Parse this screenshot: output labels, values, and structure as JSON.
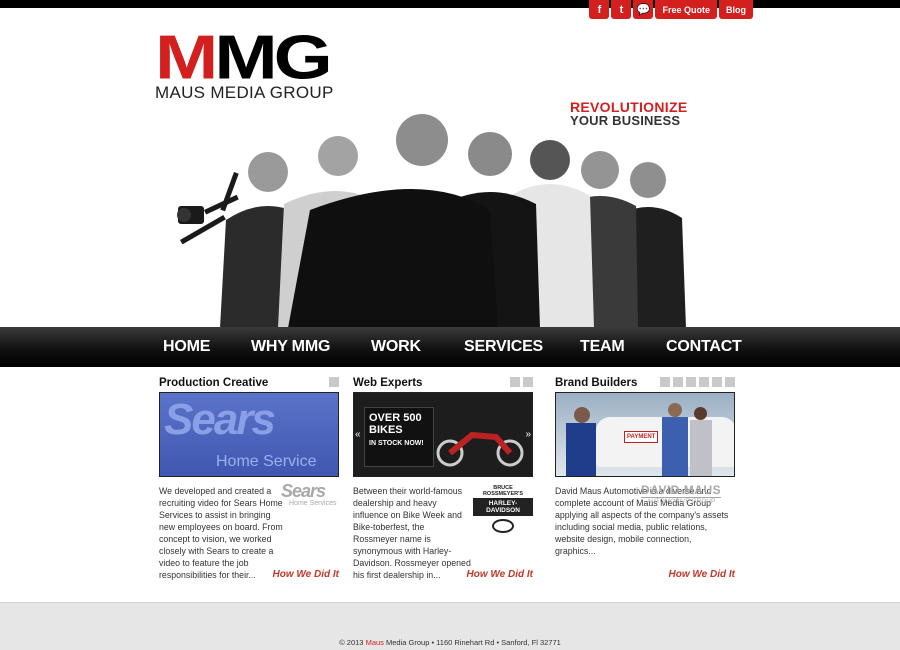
{
  "top_actions": {
    "facebook": "f",
    "twitter": "t",
    "chat": "💬",
    "free_quote": "Free Quote",
    "blog": "Blog"
  },
  "logo": {
    "mark_red": "M",
    "mark_black": "M",
    "mark_g": "G",
    "name": "MAUS MEDIA GROUP"
  },
  "tagline": {
    "line1": "REVOLUTIONIZE",
    "line2": "YOUR BUSINESS"
  },
  "nav": {
    "items": [
      "HOME",
      "WHY MMG",
      "WORK",
      "SERVICES",
      "TEAM",
      "CONTACT"
    ]
  },
  "columns": [
    {
      "title": "Production Creative",
      "thumb_text": "Sears",
      "thumb_sub": "Home Service",
      "brand": "Sears",
      "brand_sub": "Home Services",
      "body": "We developed and created a recruiting video for Sears Home Services to assist in bringing new employees on board. From concept to vision, we worked closely with Sears to create a video to feature the job responsibilities for their...",
      "link": "How We Did It"
    },
    {
      "title": "Web Experts",
      "thumb_text": "OVER 500 BIKES",
      "thumb_sub": "IN STOCK NOW!",
      "brand": "HARLEY-DAVIDSON",
      "brand_sub": "BRUCE ROSSMEYER'S",
      "body": "Between their world-famous dealership and heavy influence on Bike Week and Bike-toberfest, the Rossmeyer name is synonymous with Harley-Davidson. Rossmeyer opened his first dealership in...",
      "link": "How We Did It"
    },
    {
      "title": "Brand Builders",
      "thumb_text": "PAYMENT",
      "brand": "DAVID MAUS",
      "brand_sub": "AUTOMOTIVE GROUP",
      "body": "David Maus Automotive is a diverse and complete account of Maus Media Group applying all aspects of the company's assets including social media, public relations, website design, mobile connection, graphics...",
      "link": "How We Did It"
    }
  ],
  "footer": {
    "prefix": "© 2013 ",
    "brand": "Maus",
    "rest": " Media Group • 1160 Rinehart Rd • Sanford, Fl 32771"
  },
  "colors": {
    "accent": "#d41f1f",
    "nav_bg": "#111111",
    "footer_bg": "#e6e6e6"
  }
}
